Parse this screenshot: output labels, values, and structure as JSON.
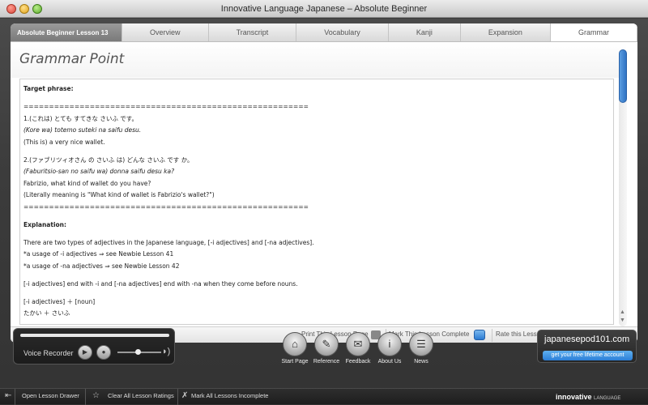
{
  "window": {
    "title": "Innovative Language Japanese – Absolute Beginner"
  },
  "tabs": {
    "lesson": "Absolute Beginner Lesson 13",
    "items": [
      "Overview",
      "Transcript",
      "Vocabulary",
      "Kanji",
      "Expansion",
      "Grammar"
    ],
    "active": "Grammar"
  },
  "grammar": {
    "heading": "Grammar Point",
    "lines": [
      {
        "text": "Target phrase:",
        "style": "bold"
      },
      {
        "text": "",
        "style": "gap"
      },
      {
        "text": "========================================================",
        "style": ""
      },
      {
        "text": "1.(これは) とても すてきな さいふ です。",
        "style": ""
      },
      {
        "text": "(Kore wa) totemo suteki na saifu desu.",
        "style": "ital"
      },
      {
        "text": "(This is) a very nice wallet.",
        "style": ""
      },
      {
        "text": "",
        "style": "gap"
      },
      {
        "text": "2.(ファブリツィオさん の さいふ は) どんな さいふ です か。",
        "style": ""
      },
      {
        "text": "(Faburitsio-san no saifu wa) donna saifu desu ka?",
        "style": "ital"
      },
      {
        "text": "Fabrizio, what kind of wallet do you have?",
        "style": ""
      },
      {
        "text": "(Literally meaning is \"What kind of wallet is Fabrizio's wallet?\")",
        "style": ""
      },
      {
        "text": "========================================================",
        "style": ""
      },
      {
        "text": "",
        "style": "gap"
      },
      {
        "text": "Explanation:",
        "style": "bold"
      },
      {
        "text": "",
        "style": "gap"
      },
      {
        "text": "There are two types of adjectives in the Japanese language, [-i adjectives] and [-na adjectives].",
        "style": ""
      },
      {
        "text": "*a usage of -i adjectives   ⇒   see Newbie Lesson 41",
        "style": ""
      },
      {
        "text": "*a usage of -na adjectives   ⇒   see Newbie Lesson 42",
        "style": ""
      },
      {
        "text": "",
        "style": "gap"
      },
      {
        "text": "[-i adjectives] end with -i and [-na adjectives] end with -na when they come before nouns.",
        "style": ""
      },
      {
        "text": "",
        "style": "gap"
      },
      {
        "text": "[-i adjectives]   ＋   [noun]",
        "style": ""
      },
      {
        "text": "たかい   ＋   さいふ",
        "style": ""
      }
    ]
  },
  "lesson_bar": {
    "print": "Print This Lesson Page",
    "complete": "Mark This Lesson Complete",
    "rate": "Rate this Lesson:",
    "stars": "☆☆☆☆☆"
  },
  "recorder": {
    "label": "Voice Recorder",
    "play_glyph": "▶",
    "stop_glyph": "●",
    "speaker_glyph": "◗)"
  },
  "nav_buttons": [
    {
      "label": "Start Page",
      "glyph": "⌂"
    },
    {
      "label": "Reference",
      "glyph": "✎"
    },
    {
      "label": "Feedback",
      "glyph": "✉"
    },
    {
      "label": "About Us",
      "glyph": "i"
    },
    {
      "label": "News",
      "glyph": "☰"
    }
  ],
  "promo": {
    "site": "japanesepod101.com",
    "cta": "get your free lifetime account"
  },
  "footer": {
    "open_drawer": "Open Lesson Drawer",
    "clear_ratings": "Clear All Lesson Ratings",
    "mark_incomplete": "Mark All Lessons Incomplete",
    "brand": "innovative",
    "brand_sub": "LANGUAGE"
  },
  "colors": {
    "accent": "#2f73c4",
    "panel_bg": "#ffffff",
    "app_bg": "#3a3a3a"
  }
}
